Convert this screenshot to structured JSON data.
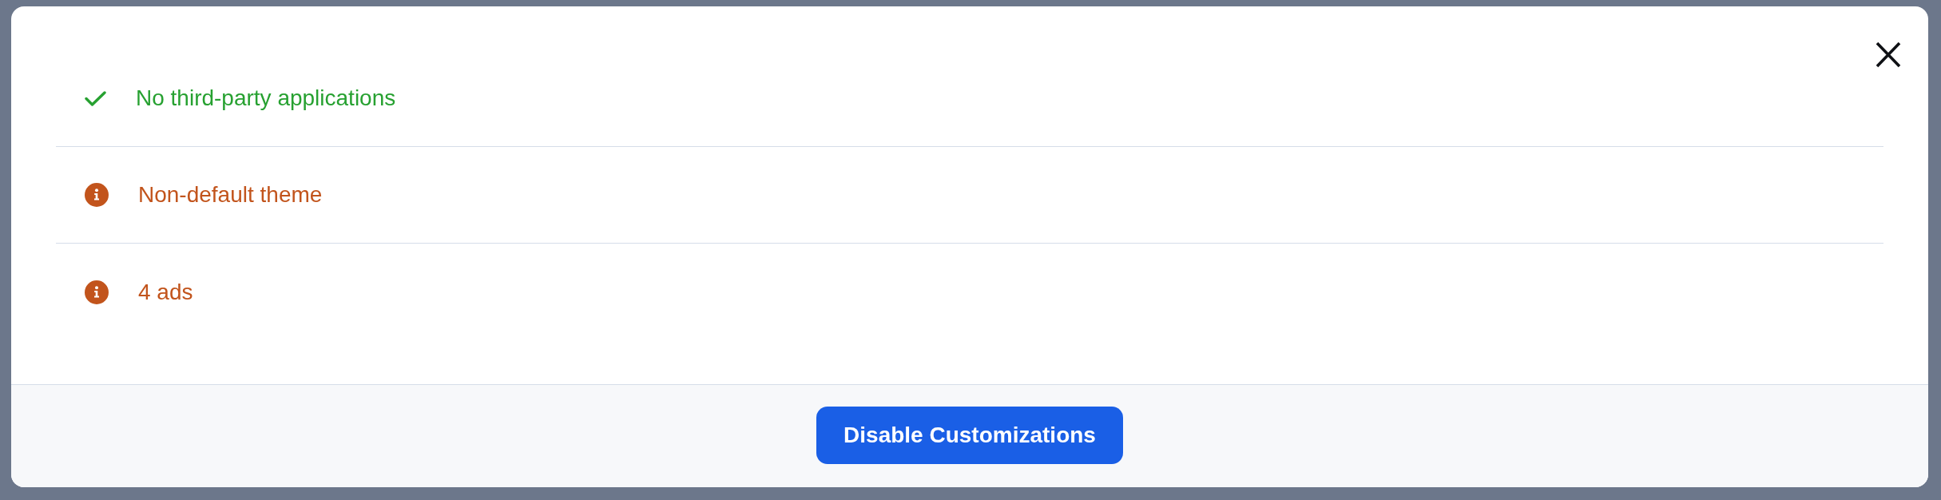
{
  "checks": [
    {
      "kind": "pass",
      "label": "No third-party applications"
    },
    {
      "kind": "warning",
      "label": "Non-default theme"
    },
    {
      "kind": "warning",
      "label": "4 ads"
    }
  ],
  "footer": {
    "button": "Disable Customizations"
  }
}
